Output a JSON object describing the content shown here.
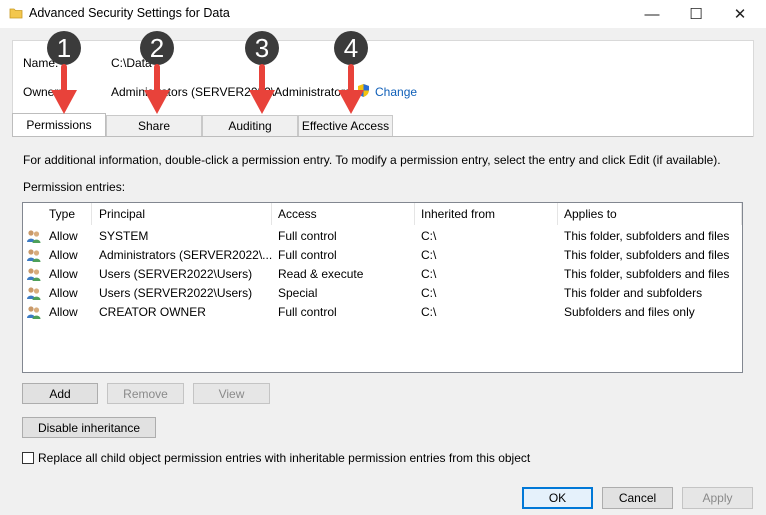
{
  "window": {
    "title": "Advanced Security Settings for Data",
    "minimize": "—",
    "maximize": "☐",
    "close": "✕"
  },
  "info": {
    "name_label": "Name:",
    "name_value": "C:\\Data",
    "owner_label": "Owner:",
    "owner_value": "Administrators (SERVER2022\\Administrators)",
    "change_link": "Change"
  },
  "tabs": [
    {
      "label": "Permissions",
      "active": true
    },
    {
      "label": "Share"
    },
    {
      "label": "Auditing"
    },
    {
      "label": "Effective Access"
    }
  ],
  "badges": [
    "1",
    "2",
    "3",
    "4"
  ],
  "instructions": "For additional information, double-click a permission entry. To modify a permission entry, select the entry and click Edit (if available).",
  "entries_label": "Permission entries:",
  "columns": [
    "Type",
    "Principal",
    "Access",
    "Inherited from",
    "Applies to"
  ],
  "rows": [
    {
      "type": "Allow",
      "principal": "SYSTEM",
      "access": "Full control",
      "inherited": "C:\\",
      "applies": "This folder, subfolders and files"
    },
    {
      "type": "Allow",
      "principal": "Administrators (SERVER2022\\...",
      "access": "Full control",
      "inherited": "C:\\",
      "applies": "This folder, subfolders and files"
    },
    {
      "type": "Allow",
      "principal": "Users (SERVER2022\\Users)",
      "access": "Read & execute",
      "inherited": "C:\\",
      "applies": "This folder, subfolders and files"
    },
    {
      "type": "Allow",
      "principal": "Users (SERVER2022\\Users)",
      "access": "Special",
      "inherited": "C:\\",
      "applies": "This folder and subfolders"
    },
    {
      "type": "Allow",
      "principal": "CREATOR OWNER",
      "access": "Full control",
      "inherited": "C:\\",
      "applies": "Subfolders and files only"
    }
  ],
  "buttons": {
    "add": "Add",
    "remove": "Remove",
    "view": "View",
    "disable_inheritance": "Disable inheritance"
  },
  "replace_checkbox": {
    "label": "Replace all child object permission entries with inheritable permission entries from this object",
    "checked": false
  },
  "footer": {
    "ok": "OK",
    "cancel": "Cancel",
    "apply": "Apply"
  },
  "colors": {
    "link": "#0f5fb8",
    "arrow": "#e8423a",
    "badge": "#3b3b3b",
    "primary_border": "#0078d7"
  }
}
